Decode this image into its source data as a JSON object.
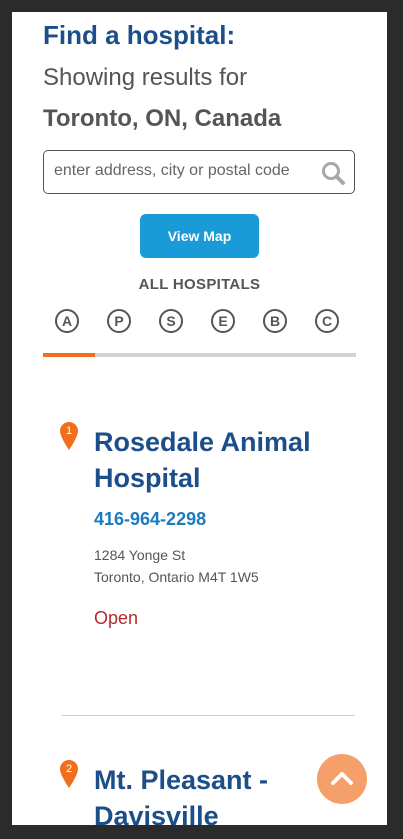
{
  "header": {
    "title": "Find a hospital:",
    "showing": "Showing results for",
    "location": "Toronto, ON, Canada"
  },
  "search": {
    "placeholder": "enter address, city or postal code",
    "value": ""
  },
  "view_map_label": "View Map",
  "filter": {
    "heading": "ALL HOSPITALS",
    "letters": [
      "A",
      "P",
      "S",
      "E",
      "B",
      "C"
    ]
  },
  "results": [
    {
      "number": "1",
      "name": "Rosedale Animal Hospital",
      "phone": "416-964-2298",
      "address_line1": "1284 Yonge St",
      "address_line2": "Toronto, Ontario M4T 1W5",
      "status": "Open"
    },
    {
      "number": "2",
      "name": "Mt. Pleasant - Davisville"
    }
  ],
  "colors": {
    "title": "#1c4f8a",
    "button": "#1a9ad6",
    "accent": "#ef6f1e",
    "phone": "#1a7ac2",
    "status_open": "#b32b2b",
    "scroll_top": "#f5a06b"
  },
  "icons": {
    "search": "search-icon",
    "pin": "map-pin-icon",
    "scroll_top": "chevron-up-icon"
  }
}
